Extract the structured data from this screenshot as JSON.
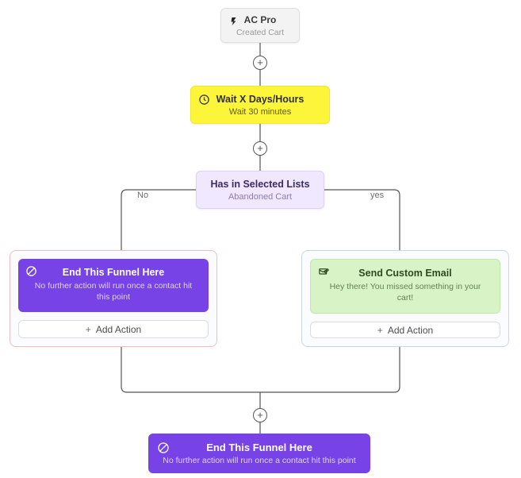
{
  "trigger": {
    "title": "AC Pro",
    "subtitle": "Created Cart"
  },
  "wait": {
    "title": "Wait X Days/Hours",
    "subtitle": "Wait 30 minutes"
  },
  "condition": {
    "title": "Has in Selected Lists",
    "subtitle": "Abandoned Cart",
    "labels": {
      "no": "No",
      "yes": "yes"
    }
  },
  "branches": {
    "no": {
      "card": {
        "title": "End This Funnel Here",
        "subtitle": "No further action will run once a contact hit this point"
      },
      "add_label": "Add Action"
    },
    "yes": {
      "card": {
        "title": "Send Custom Email",
        "subtitle": "Hey there! You missed something in your cart!"
      },
      "add_label": "Add Action"
    }
  },
  "final": {
    "title": "End This Funnel Here",
    "subtitle": "No further action will run once a contact hit this point"
  },
  "plus_glyph": "+"
}
